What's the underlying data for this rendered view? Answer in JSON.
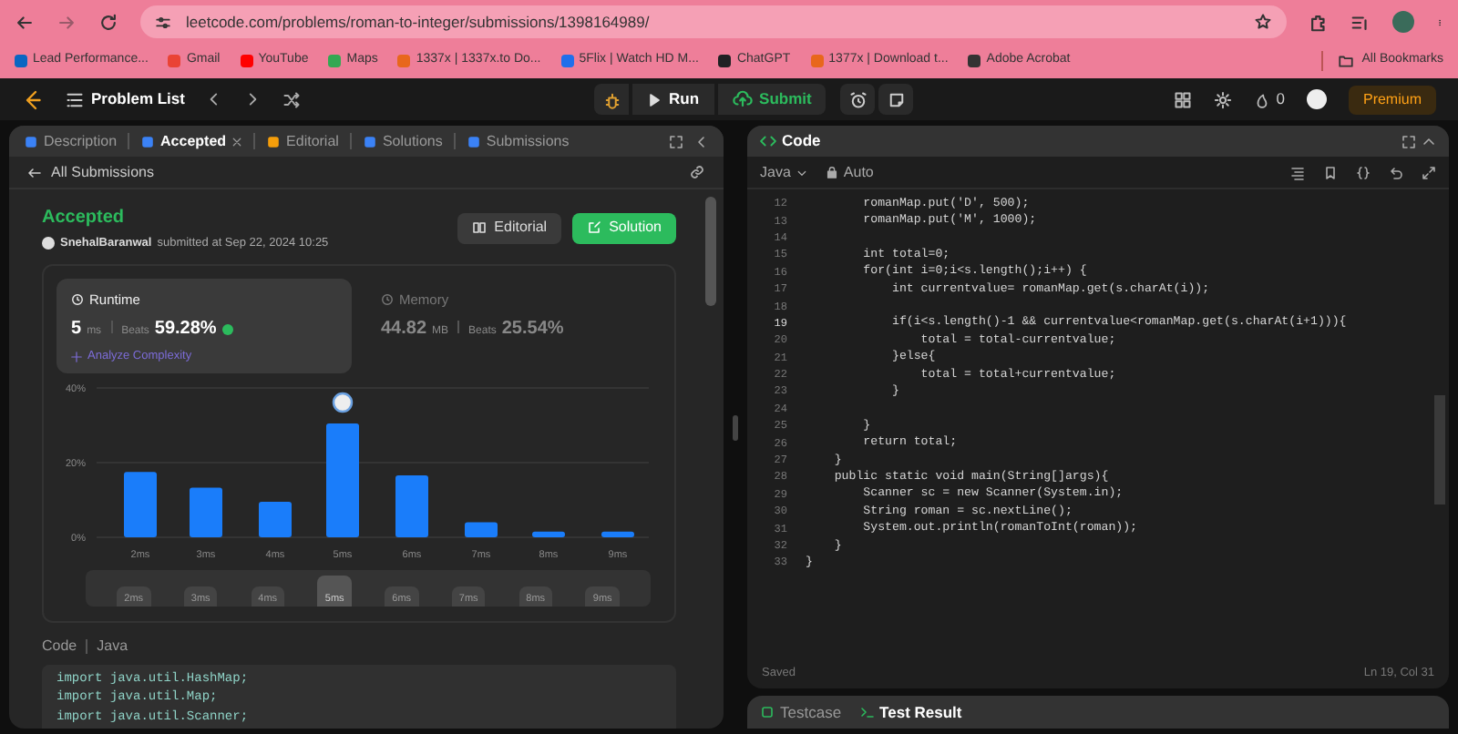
{
  "browser": {
    "url": "leetcode.com/problems/roman-to-integer/submissions/1398164989/",
    "bookmarks": [
      {
        "label": "Lead Performance...",
        "color": "#0a66c2"
      },
      {
        "label": "Gmail",
        "color": "#ea4335"
      },
      {
        "label": "YouTube",
        "color": "#ff0000"
      },
      {
        "label": "Maps",
        "color": "#34a853"
      },
      {
        "label": "1337x | 1337x.to Do...",
        "color": "#e8671c"
      },
      {
        "label": "5Flix | Watch HD M...",
        "color": "#1f6feb"
      },
      {
        "label": "ChatGPT",
        "color": "#202123"
      },
      {
        "label": "1377x | Download t...",
        "color": "#e8671c"
      },
      {
        "label": "Adobe Acrobat",
        "color": "#333333"
      }
    ],
    "all_bookmarks": "All Bookmarks"
  },
  "navbar": {
    "problem_list": "Problem List",
    "run": "Run",
    "submit": "Submit",
    "streak": "0",
    "premium": "Premium"
  },
  "left_panel": {
    "tabs": [
      {
        "label": "Description",
        "selected": false,
        "closable": false,
        "color": "#3b82f6"
      },
      {
        "label": "Accepted",
        "selected": true,
        "closable": true,
        "color": "#3b82f6"
      },
      {
        "label": "Editorial",
        "selected": false,
        "closable": false,
        "color": "#f59e0b"
      },
      {
        "label": "Solutions",
        "selected": false,
        "closable": false,
        "color": "#3b82f6"
      },
      {
        "label": "Submissions",
        "selected": false,
        "closable": false,
        "color": "#3b82f6"
      }
    ],
    "back": "All Submissions",
    "status": "Accepted",
    "user": "SnehalBaranwal",
    "submitted": "submitted at Sep 22, 2024 10:25",
    "editorial_button": "Editorial",
    "solution_button": "Solution",
    "stats": [
      {
        "title": "Runtime",
        "value": "5",
        "unit": "ms",
        "beats_label": "Beats",
        "beats": "59.28%",
        "selected": true
      },
      {
        "title": "Memory",
        "value": "44.82",
        "unit": "MB",
        "beats_label": "Beats",
        "beats": "25.54%",
        "selected": false
      }
    ],
    "analyze": "Analyze Complexity",
    "chart_data": {
      "type": "bar",
      "categories": [
        "2ms",
        "3ms",
        "4ms",
        "5ms",
        "6ms",
        "7ms",
        "8ms",
        "9ms"
      ],
      "series": [
        {
          "color": "#1a7dfa",
          "values": [
            17.5,
            13.3,
            9.5,
            30.5,
            16.6,
            4,
            1.5,
            1.5
          ]
        }
      ],
      "ylim": [
        0,
        40
      ],
      "yticks": [
        {
          "value": 0,
          "label": "0%"
        },
        {
          "value": 20,
          "label": "20%"
        },
        {
          "value": 40,
          "label": "40%"
        }
      ]
    },
    "range": [
      {
        "label": "2ms",
        "selected": false
      },
      {
        "label": "3ms",
        "selected": false
      },
      {
        "label": "4ms",
        "selected": false
      },
      {
        "label": "5ms",
        "selected": true
      },
      {
        "label": "6ms",
        "selected": false
      },
      {
        "label": "7ms",
        "selected": false
      },
      {
        "label": "8ms",
        "selected": false
      },
      {
        "label": "9ms",
        "selected": false
      }
    ],
    "code_label": "Code",
    "language": "Java",
    "code_preview": [
      "import java.util.HashMap;",
      "import java.util.Map;",
      "import java.util.Scanner;"
    ]
  },
  "right_panel": {
    "title": "Code",
    "language": "Java",
    "mode": "Auto",
    "lines": [
      {
        "number": "12",
        "code": "        romanMap.put('D', 500);",
        "current": false
      },
      {
        "number": "13",
        "code": "        romanMap.put('M', 1000);",
        "current": false
      },
      {
        "number": "14",
        "current": false
      },
      {
        "number": "15",
        "code": "        int total=0;",
        "current": false
      },
      {
        "number": "16",
        "code": "        for(int i=0;i<s.length();i++) {",
        "current": false
      },
      {
        "number": "17",
        "code": "            int currentvalue= romanMap.get(s.charAt(i));",
        "current": false
      },
      {
        "number": "18",
        "current": false
      },
      {
        "number": "19",
        "code": "            if(i<s.length()-1 && currentvalue<romanMap.get(s.charAt(i+1))){",
        "current": true
      },
      {
        "number": "20",
        "code": "                total = total-currentvalue;",
        "current": false
      },
      {
        "number": "21",
        "code": "            }else{",
        "current": false
      },
      {
        "number": "22",
        "code": "                total = total+currentvalue;",
        "current": false
      },
      {
        "number": "23",
        "code": "            }",
        "current": false
      },
      {
        "number": "24",
        "current": false
      },
      {
        "number": "25",
        "code": "        }",
        "current": false
      },
      {
        "number": "26",
        "code": "        return total;",
        "current": false
      },
      {
        "number": "27",
        "code": "    }",
        "current": false
      },
      {
        "number": "28",
        "code": "    public static void main(String[]args){",
        "current": false
      },
      {
        "number": "29",
        "code": "        Scanner sc = new Scanner(System.in);",
        "current": false
      },
      {
        "number": "30",
        "code": "        String roman = sc.nextLine();",
        "current": false
      },
      {
        "number": "31",
        "code": "        System.out.println(romanToInt(roman));",
        "current": false
      },
      {
        "number": "32",
        "code": "    }",
        "current": false
      },
      {
        "number": "33",
        "code": "}",
        "current": false
      }
    ],
    "saved": "Saved",
    "cursor": "Ln 19, Col 31",
    "bottom_tabs": [
      {
        "label": "Testcase",
        "selected": false
      },
      {
        "label": "Test Result",
        "selected": true
      }
    ]
  }
}
